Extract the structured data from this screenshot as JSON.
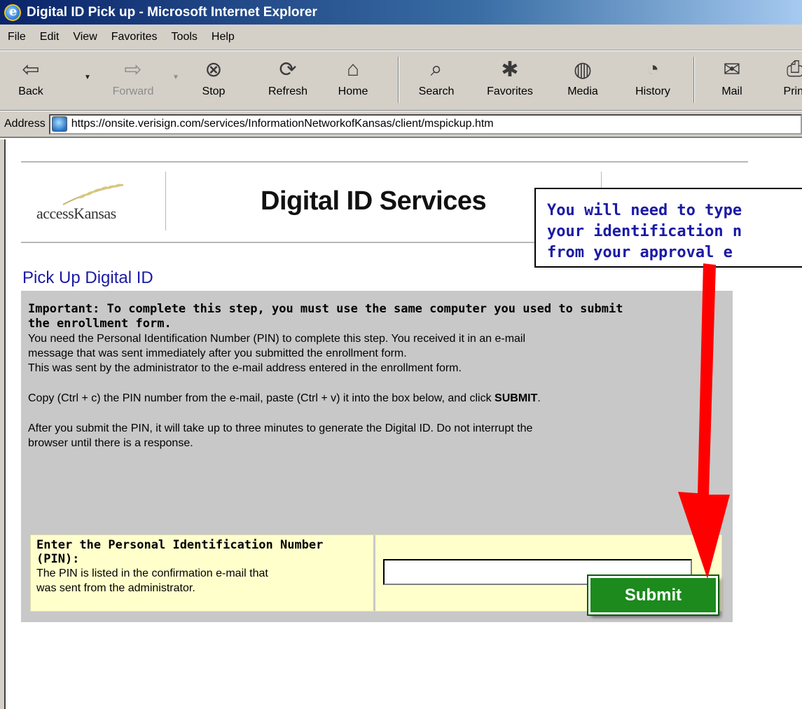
{
  "window": {
    "title": "Digital ID Pick up - Microsoft Internet Explorer"
  },
  "menu": [
    "File",
    "Edit",
    "View",
    "Favorites",
    "Tools",
    "Help"
  ],
  "toolbar": {
    "back": "Back",
    "forward": "Forward",
    "stop": "Stop",
    "refresh": "Refresh",
    "home": "Home",
    "search": "Search",
    "favorites": "Favorites",
    "media": "Media",
    "history": "History",
    "mail": "Mail",
    "print": "Print"
  },
  "address": {
    "label": "Address",
    "url": "https://onsite.verisign.com/services/InformationNetworkofKansas/client/mspickup.htm"
  },
  "banner": {
    "logo_text": "accessKansas",
    "title": "Digital ID Services"
  },
  "page": {
    "heading": "Pick Up Digital ID",
    "important_line1": "Important: To complete this step, you must use the same computer you used to submit",
    "important_line2": "the enrollment form.",
    "p1_line1": "You need the Personal Identification Number (PIN) to complete this step. You received it in an e-mail",
    "p1_line2": "message that was sent immediately after you submitted the enrollment form.",
    "p1_line3": "This was sent by the administrator to the e-mail address entered in the enrollment form.",
    "p2_text": "Copy (Ctrl + c) the PIN number from the e-mail, paste (Ctrl + v) it into the box below, and click ",
    "p2_bold": "SUBMIT",
    "p2_end": ".",
    "p3_line1": "After you submit the PIN, it will take up to three minutes to generate the Digital ID. Do not interrupt the",
    "p3_line2": "browser until there is a response."
  },
  "pin": {
    "label_line1": "Enter the Personal Identification Number",
    "label_line2": "(PIN):",
    "help_line1": "The PIN is listed in the confirmation e-mail that",
    "help_line2": "was sent from the administrator.",
    "value": ""
  },
  "submit_label": "Submit",
  "callout": {
    "line1": "You will need to type",
    "line2": "your identification n",
    "line3": "from your approval e"
  },
  "colors": {
    "accent_red": "#ff0000",
    "submit_green": "#1c8a1c",
    "heading_blue": "#1a1aa6",
    "panel_gray": "#c8c8c8",
    "pin_yellow": "#ffffcc"
  }
}
